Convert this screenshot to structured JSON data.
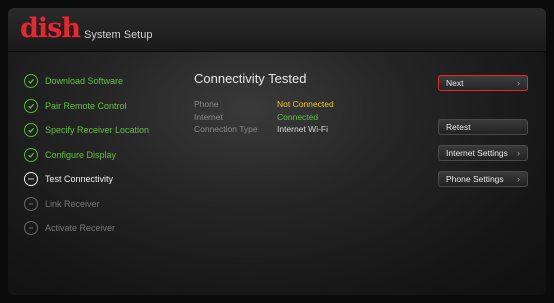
{
  "header": {
    "logo_text": "dish",
    "title": "System Setup"
  },
  "steps": [
    {
      "label": "Download Software",
      "status": "done"
    },
    {
      "label": "Pair Remote Control",
      "status": "done"
    },
    {
      "label": "Specify Receiver Location",
      "status": "done"
    },
    {
      "label": "Configure Display",
      "status": "done"
    },
    {
      "label": "Test Connectivity",
      "status": "current"
    },
    {
      "label": "Link Receiver",
      "status": "pending"
    },
    {
      "label": "Activate Receiver",
      "status": "pending"
    }
  ],
  "main": {
    "title": "Connectivity Tested",
    "rows": [
      {
        "label": "Phone",
        "value": "Not Connected"
      },
      {
        "label": "Internet",
        "value": "Connected"
      },
      {
        "label": "Connection Type",
        "value": "Internet Wi-Fi"
      }
    ]
  },
  "buttons": {
    "next": "Next",
    "retest": "Retest",
    "internet_settings": "Internet Settings",
    "phone_settings": "Phone Settings",
    "chevron": "›"
  },
  "colors": {
    "brand_red": "#e8262f",
    "done_green": "#5fc43a",
    "warning_yellow": "#f0c419"
  }
}
